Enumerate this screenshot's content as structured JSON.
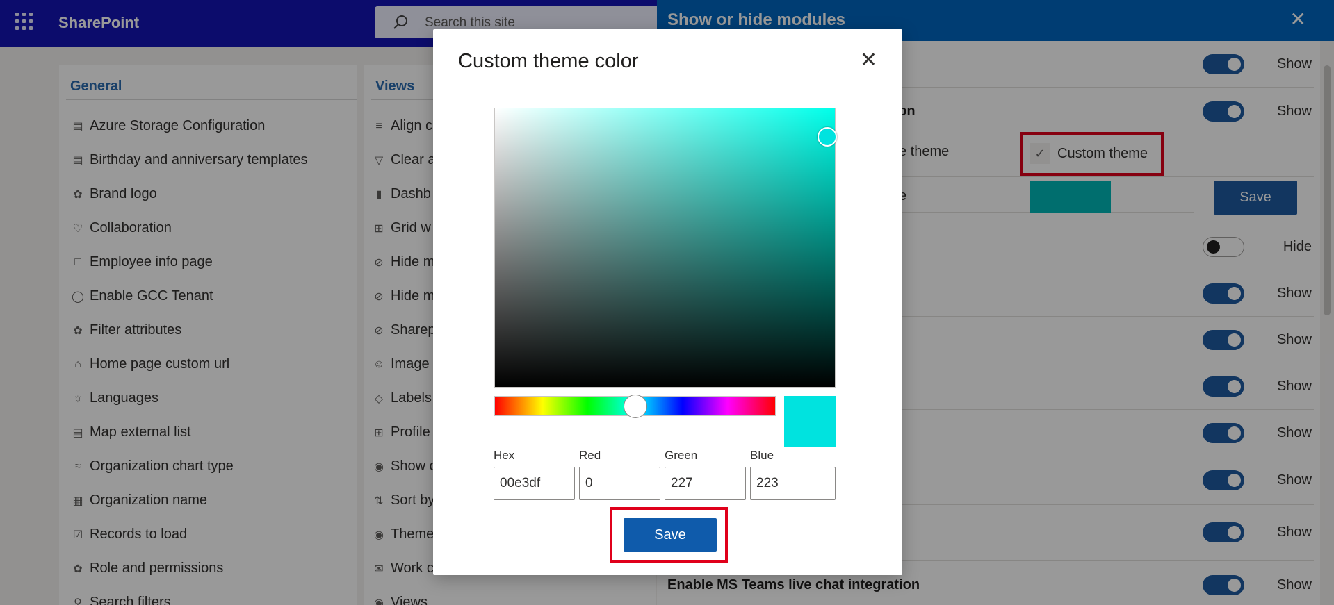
{
  "app": {
    "name": "SharePoint",
    "search_placeholder": "Search this site"
  },
  "general": {
    "heading": "General",
    "items": [
      {
        "label": "Azure Storage Configuration",
        "icon": "database-icon"
      },
      {
        "label": "Birthday and anniversary templates",
        "icon": "cake-icon"
      },
      {
        "label": "Brand logo",
        "icon": "badge-icon"
      },
      {
        "label": "Collaboration",
        "icon": "handshake-icon"
      },
      {
        "label": "Employee info page",
        "icon": "person-page-icon"
      },
      {
        "label": "Enable GCC Tenant",
        "icon": "globe-icon"
      },
      {
        "label": "Filter attributes",
        "icon": "filter-badge-icon"
      },
      {
        "label": "Home page custom url",
        "icon": "home-icon"
      },
      {
        "label": "Languages",
        "icon": "translate-icon"
      },
      {
        "label": "Map external list",
        "icon": "map-list-icon"
      },
      {
        "label": "Organization chart type",
        "icon": "chart-icon"
      },
      {
        "label": "Organization name",
        "icon": "org-icon"
      },
      {
        "label": "Records to load",
        "icon": "records-icon"
      },
      {
        "label": "Role and permissions",
        "icon": "shield-badge-icon"
      },
      {
        "label": "Search filters",
        "icon": "search-icon"
      }
    ]
  },
  "views": {
    "heading": "Views",
    "items": [
      {
        "label": "Align c",
        "icon": "align-icon"
      },
      {
        "label": "Clear a",
        "icon": "filter-icon"
      },
      {
        "label": "Dashb",
        "icon": "dashboard-icon"
      },
      {
        "label": "Grid w",
        "icon": "grid-icon"
      },
      {
        "label": "Hide m",
        "icon": "hide-icon"
      },
      {
        "label": "Hide m",
        "icon": "hide-icon"
      },
      {
        "label": "Sharep",
        "icon": "hide-icon"
      },
      {
        "label": "Image",
        "icon": "person-icon"
      },
      {
        "label": "Labels",
        "icon": "tag-icon"
      },
      {
        "label": "Profile",
        "icon": "profile-icon"
      },
      {
        "label": "Show c",
        "icon": "eye-icon"
      },
      {
        "label": "Sort by",
        "icon": "sort-icon"
      },
      {
        "label": "Theme",
        "icon": "palette-icon"
      },
      {
        "label": "Work c",
        "icon": "mail-icon"
      },
      {
        "label": "Views",
        "icon": "eye-icon"
      }
    ]
  },
  "panel": {
    "title": "Show or hide modules",
    "rows": [
      {
        "label": "",
        "state": "Show",
        "on": true
      },
      {
        "label": "tion",
        "state": "Show",
        "on": true
      },
      {
        "label": "",
        "state": "Hide",
        "on": false
      },
      {
        "label": "",
        "state": "Show",
        "on": true
      },
      {
        "label": "",
        "state": "Show",
        "on": true
      },
      {
        "label": "",
        "state": "Show",
        "on": true
      },
      {
        "label": "",
        "state": "Show",
        "on": true
      },
      {
        "label": "",
        "state": "Show",
        "on": true
      },
      {
        "label": "",
        "state": "Show",
        "on": true
      },
      {
        "label": "Enable MS Teams live chat integration",
        "state": "Show",
        "on": true
      }
    ],
    "theme_option": "e theme",
    "custom_theme_label": "Custom theme",
    "color_row_stub": "e",
    "save_label": "Save"
  },
  "modal": {
    "title": "Custom theme color",
    "fields": [
      {
        "label": "Hex",
        "value": "00e3df"
      },
      {
        "label": "Red",
        "value": "0"
      },
      {
        "label": "Green",
        "value": "227"
      },
      {
        "label": "Blue",
        "value": "223"
      }
    ],
    "save_label": "Save",
    "hue_position": 0.5,
    "selected_color": "#00e3df"
  },
  "colors": {
    "topbar": "#1414b4",
    "panel_header": "#0067c0",
    "accent": "#1e5aa0",
    "highlight": "#e0001b"
  }
}
